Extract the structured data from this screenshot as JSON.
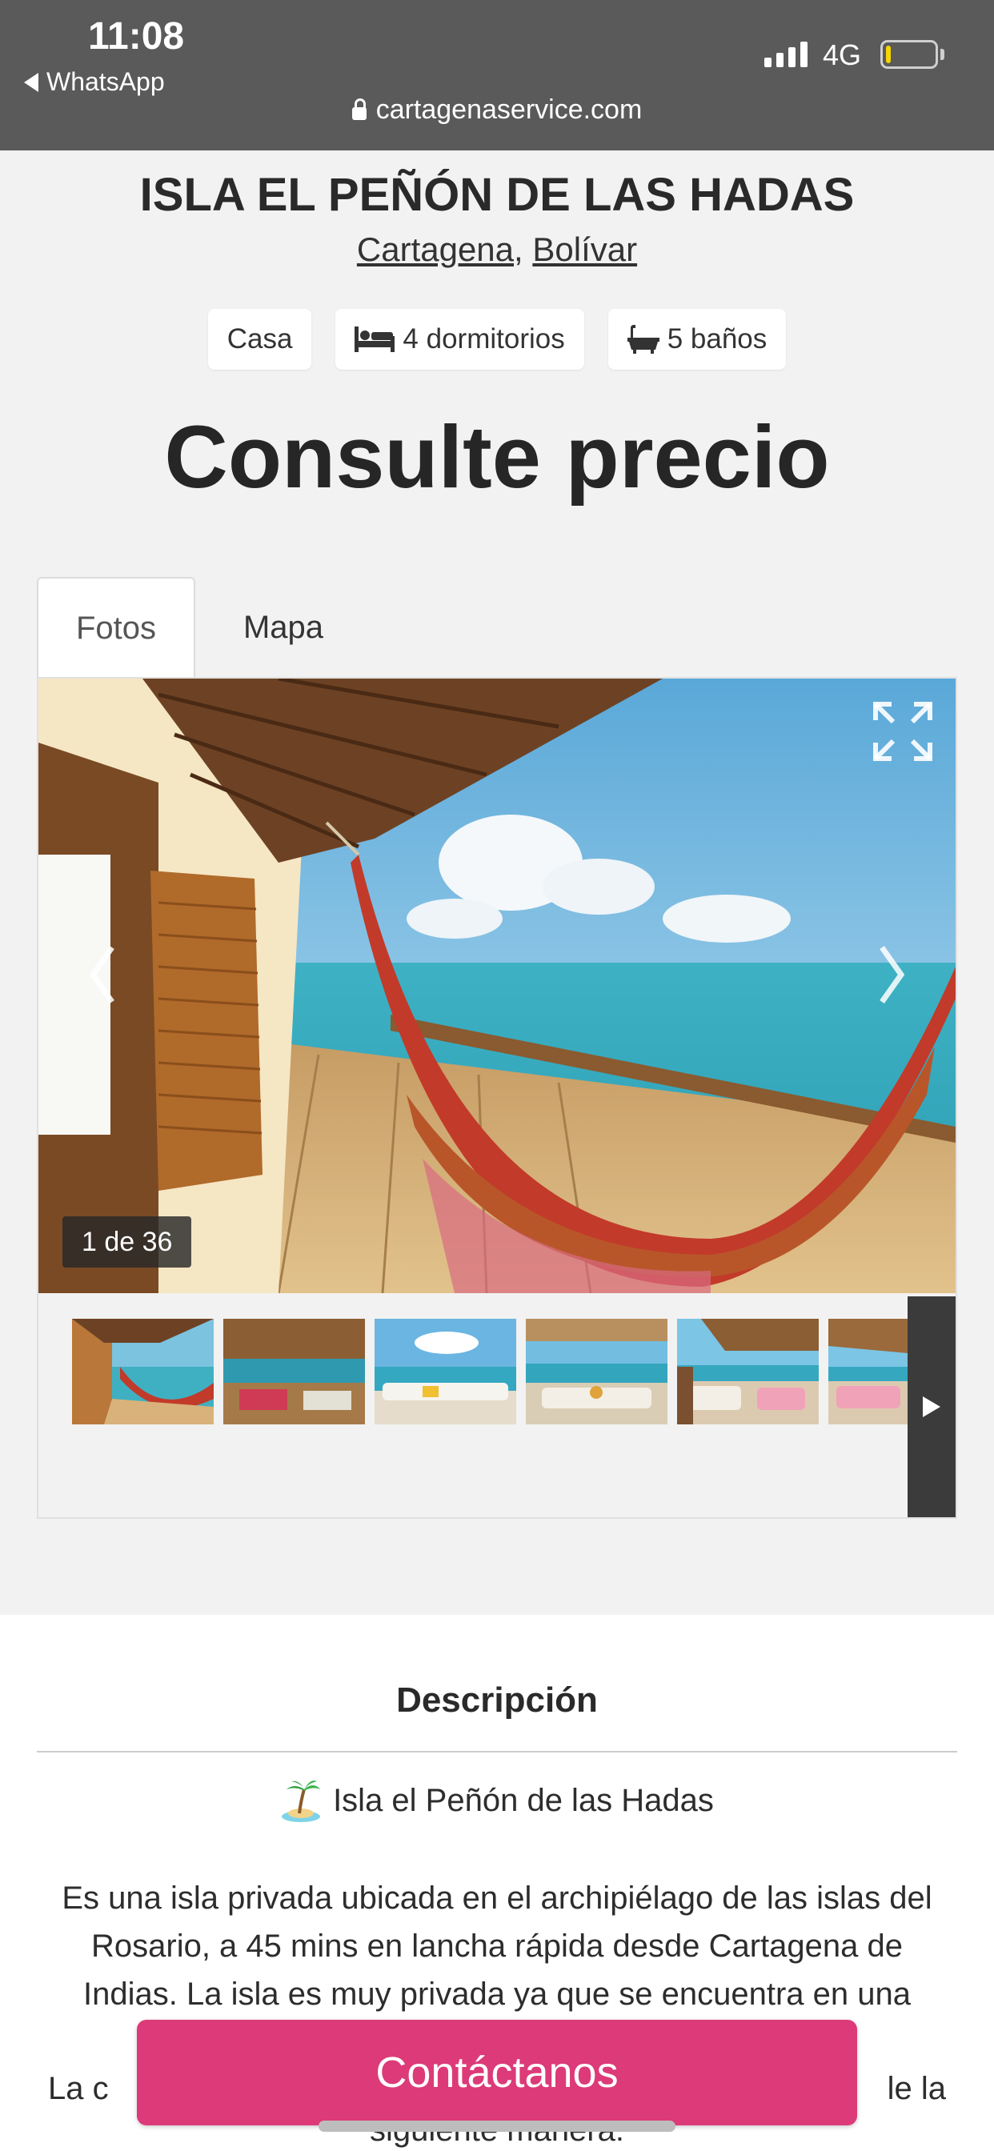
{
  "status_bar": {
    "time": "11:08",
    "back_app": "WhatsApp",
    "network": "4G",
    "battery_level": 0.1
  },
  "browser": {
    "url": "cartagenaservice.com"
  },
  "listing": {
    "title": "ISLA EL PEÑÓN DE LAS HADAS",
    "city": "Cartagena",
    "separator": ",",
    "region": "Bolívar",
    "chips": {
      "type": "Casa",
      "bedrooms": "4 dormitorios",
      "bathrooms": "5 baños"
    },
    "price": "Consulte precio"
  },
  "tabs": {
    "photos": "Fotos",
    "map": "Mapa"
  },
  "gallery": {
    "counter": "1 de 36",
    "icons": {
      "prev": "chevron-left-icon",
      "next": "chevron-right-icon",
      "expand": "expand-icon"
    }
  },
  "description": {
    "heading": "Descripción",
    "emoji_subtitle": "Isla el Peñón de las Hadas",
    "paragraph": "Es una isla privada ubicada en el archipiélago de las islas del Rosario, a 45 mins en lancha rápida desde Cartagena de Indias. La isla es muy privada ya que se encuentra en una",
    "partial_line_left": "La c",
    "partial_line_right": "le la",
    "partial_line_next": "siguiente manera:"
  },
  "cta": {
    "contact": "Contáctanos"
  },
  "colors": {
    "accent": "#dc3a78",
    "topbar": "#5a5a5a",
    "page_bg": "#f2f2f2"
  }
}
